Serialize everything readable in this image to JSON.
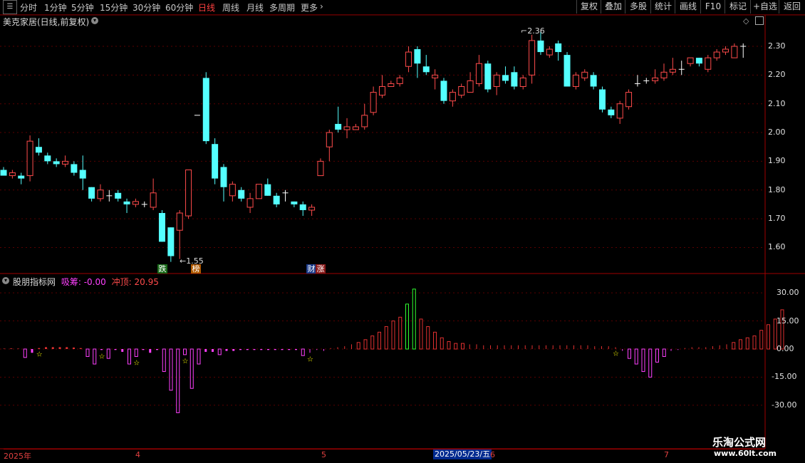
{
  "toolbar": {
    "periods": [
      "分时",
      "1分钟",
      "5分钟",
      "15分钟",
      "30分钟",
      "60分钟",
      "日线",
      "周线",
      "月线",
      "多周期",
      "更多"
    ],
    "active_period": "日线",
    "right_buttons": [
      "复权",
      "叠加",
      "多股",
      "统计",
      "画线",
      "F10",
      "标记",
      "+自选",
      "返回"
    ]
  },
  "chart_title": "美克家居(日线,前复权)",
  "indicator": {
    "name": "股朋指标网",
    "line1_label": "吸筹:",
    "line1_value": "-0.00",
    "line2_label": "冲顶:",
    "line2_value": "20.95"
  },
  "price_axis": [
    "2.30",
    "2.20",
    "2.10",
    "2.00",
    "1.90",
    "1.80",
    "1.70",
    "1.60"
  ],
  "indicator_axis": [
    "30.00",
    "15.00",
    "0.00",
    "-15.00",
    "-30.00"
  ],
  "annotations": {
    "high": "2.36",
    "low": "1.55"
  },
  "event_tags": [
    "跌",
    "榜",
    "财",
    "涨"
  ],
  "x_axis": {
    "labels": [
      "2025年",
      "4",
      "5",
      "6",
      "7"
    ],
    "cursor_date": "2025/05/23/五"
  },
  "watermark": {
    "line1": "乐淘公式网",
    "line2": "www.60lt.com"
  },
  "colors": {
    "up": "#ff4b4b",
    "down": "#54ffff",
    "flat": "#ffffff",
    "bar_neg": "#ff40ff",
    "bar_pos": "#e03030",
    "bar_peak": "#30ff30",
    "star": "#ffff00"
  },
  "chart_data": [
    {
      "type": "candlestick",
      "title": "美克家居(日线,前复权)",
      "ylim": [
        1.55,
        2.36
      ],
      "candles": [
        [
          1.87,
          1.85,
          1.86,
          1.88
        ],
        [
          1.85,
          1.86,
          1.84,
          1.87
        ],
        [
          1.85,
          1.84,
          1.82,
          1.86
        ],
        [
          1.85,
          1.97,
          1.83,
          1.99
        ],
        [
          1.95,
          1.93,
          1.92,
          1.98
        ],
        [
          1.92,
          1.9,
          1.89,
          1.93
        ],
        [
          1.9,
          1.89,
          1.88,
          1.91
        ],
        [
          1.89,
          1.9,
          1.88,
          1.92
        ],
        [
          1.89,
          1.86,
          1.85,
          1.9
        ],
        [
          1.87,
          1.84,
          1.8,
          1.92
        ],
        [
          1.81,
          1.77,
          1.76,
          1.81
        ],
        [
          1.77,
          1.8,
          1.76,
          1.82
        ],
        [
          1.78,
          1.78,
          1.76,
          1.8
        ],
        [
          1.79,
          1.77,
          1.76,
          1.8
        ],
        [
          1.76,
          1.75,
          1.72,
          1.77
        ],
        [
          1.75,
          1.76,
          1.74,
          1.77
        ],
        [
          1.75,
          1.75,
          1.74,
          1.76
        ],
        [
          1.74,
          1.79,
          1.73,
          1.84
        ],
        [
          1.72,
          1.62,
          1.62,
          1.73
        ],
        [
          1.67,
          1.57,
          1.55,
          1.67
        ],
        [
          1.66,
          1.72,
          1.56,
          1.73
        ],
        [
          1.71,
          1.87,
          1.7,
          1.87
        ],
        [
          2.06,
          2.06,
          2.06,
          2.06
        ],
        [
          2.19,
          1.97,
          1.96,
          2.21
        ],
        [
          1.96,
          1.84,
          1.82,
          1.98
        ],
        [
          1.88,
          1.81,
          1.76,
          1.89
        ],
        [
          1.78,
          1.82,
          1.76,
          1.83
        ],
        [
          1.8,
          1.77,
          1.76,
          1.81
        ],
        [
          1.74,
          1.77,
          1.72,
          1.79
        ],
        [
          1.77,
          1.82,
          1.77,
          1.82
        ],
        [
          1.82,
          1.78,
          1.78,
          1.84
        ],
        [
          1.78,
          1.75,
          1.74,
          1.79
        ],
        [
          1.79,
          1.79,
          1.76,
          1.8
        ],
        [
          1.76,
          1.75,
          1.74,
          1.76
        ],
        [
          1.75,
          1.73,
          1.71,
          1.76
        ],
        [
          1.73,
          1.74,
          1.71,
          1.75
        ],
        [
          1.85,
          1.9,
          1.85,
          1.91
        ],
        [
          1.95,
          2.0,
          1.9,
          2.01
        ],
        [
          2.03,
          2.01,
          2.0,
          2.09
        ],
        [
          2.01,
          2.02,
          1.98,
          2.05
        ],
        [
          2.01,
          2.02,
          2.01,
          2.03
        ],
        [
          2.02,
          2.06,
          2.01,
          2.1
        ],
        [
          2.07,
          2.14,
          2.06,
          2.16
        ],
        [
          2.13,
          2.16,
          2.12,
          2.2
        ],
        [
          2.16,
          2.17,
          2.16,
          2.18
        ],
        [
          2.17,
          2.19,
          2.16,
          2.2
        ],
        [
          2.23,
          2.28,
          2.21,
          2.3
        ],
        [
          2.29,
          2.24,
          2.19,
          2.3
        ],
        [
          2.23,
          2.21,
          2.2,
          2.27
        ],
        [
          2.19,
          2.2,
          2.15,
          2.22
        ],
        [
          2.18,
          2.11,
          2.1,
          2.19
        ],
        [
          2.11,
          2.14,
          2.09,
          2.15
        ],
        [
          2.13,
          2.16,
          2.12,
          2.17
        ],
        [
          2.14,
          2.18,
          2.14,
          2.21
        ],
        [
          2.17,
          2.24,
          2.16,
          2.27
        ],
        [
          2.24,
          2.15,
          2.14,
          2.25
        ],
        [
          2.16,
          2.2,
          2.13,
          2.21
        ],
        [
          2.2,
          2.18,
          2.17,
          2.23
        ],
        [
          2.21,
          2.16,
          2.15,
          2.23
        ],
        [
          2.16,
          2.19,
          2.15,
          2.2
        ],
        [
          2.2,
          2.32,
          2.17,
          2.34
        ],
        [
          2.32,
          2.28,
          2.27,
          2.35
        ],
        [
          2.27,
          2.29,
          2.26,
          2.3
        ],
        [
          2.31,
          2.28,
          2.25,
          2.32
        ],
        [
          2.27,
          2.16,
          2.16,
          2.28
        ],
        [
          2.16,
          2.2,
          2.15,
          2.21
        ],
        [
          2.19,
          2.21,
          2.18,
          2.22
        ],
        [
          2.2,
          2.16,
          2.15,
          2.21
        ],
        [
          2.15,
          2.08,
          2.07,
          2.16
        ],
        [
          2.08,
          2.06,
          2.05,
          2.09
        ],
        [
          2.05,
          2.1,
          2.03,
          2.11
        ],
        [
          2.09,
          2.14,
          2.08,
          2.15
        ],
        [
          2.17,
          2.17,
          2.16,
          2.2
        ],
        [
          2.18,
          2.18,
          2.17,
          2.19
        ],
        [
          2.18,
          2.19,
          2.17,
          2.22
        ],
        [
          2.19,
          2.21,
          2.18,
          2.24
        ],
        [
          2.21,
          2.22,
          2.2,
          2.26
        ],
        [
          2.22,
          2.22,
          2.2,
          2.25
        ],
        [
          2.24,
          2.26,
          2.23,
          2.26
        ],
        [
          2.26,
          2.24,
          2.23,
          2.26
        ],
        [
          2.22,
          2.26,
          2.21,
          2.27
        ],
        [
          2.26,
          2.28,
          2.25,
          2.29
        ],
        [
          2.28,
          2.29,
          2.27,
          2.3
        ],
        [
          2.26,
          2.3,
          2.26,
          2.31
        ],
        [
          2.3,
          2.3,
          2.26,
          2.31
        ]
      ]
    },
    {
      "type": "bar",
      "title": "股朋指标网",
      "ylim": [
        -34,
        22
      ],
      "values": [
        0.2,
        0.3,
        0.2,
        -4.5,
        -2,
        0.5,
        1,
        1,
        1,
        1,
        0.8,
        0.5,
        -4,
        -8,
        -0.5,
        -5,
        -0.5,
        -1.5,
        -8,
        -4,
        -0.5,
        -2,
        -0.5,
        -12,
        -22,
        -34,
        -3,
        -21,
        -8,
        -1.5,
        -1.5,
        -3,
        -1,
        -1,
        -0.5,
        -0.5,
        -0.5,
        -0.5,
        -0.5,
        -0.5,
        -0.5,
        -0.5,
        -0.5,
        -3.5,
        -2,
        -0.5,
        -1,
        0.5,
        1,
        1.5,
        2.5,
        3.5,
        5,
        7,
        9,
        12,
        15,
        17,
        24,
        32,
        16,
        12,
        9,
        6,
        4,
        3,
        3,
        2.5,
        2.5,
        2,
        2,
        2,
        2,
        2,
        2,
        2,
        2,
        2,
        2,
        2,
        2,
        2,
        2,
        2,
        2,
        1.5,
        1.5,
        1.5,
        1,
        -1,
        -5,
        -8,
        -12,
        -15,
        -7,
        -4,
        -1,
        -0.5,
        0.5,
        1,
        1,
        1,
        1.5,
        2,
        2.5,
        3.5,
        5,
        6,
        7,
        10,
        13,
        16,
        20.95
      ]
    }
  ]
}
